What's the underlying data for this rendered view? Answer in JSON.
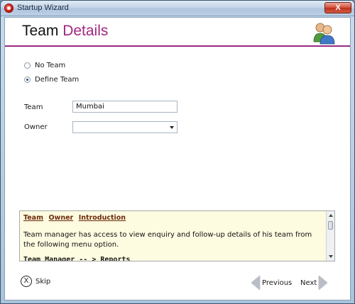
{
  "window": {
    "title": "Startup Wizard",
    "close_label": "X"
  },
  "header": {
    "title_part1": "Team",
    "title_part2": "Details",
    "accent_color": "#a12880",
    "icon": "users-icon"
  },
  "team_mode": {
    "options": [
      {
        "label": "No Team",
        "checked": false
      },
      {
        "label": "Define Team",
        "checked": true
      }
    ]
  },
  "form": {
    "team_label": "Team",
    "team_value": "Mumbai",
    "owner_label": "Owner",
    "owner_value": ""
  },
  "info": {
    "links": [
      "Team",
      "Owner",
      "Introduction"
    ],
    "body": "Team manager has access to view enquiry and follow-up details of his team from the following menu option.",
    "bold_line": "Team Manager -- > Reports"
  },
  "footer": {
    "skip_icon": "X",
    "skip_label": "Skip",
    "previous_label": "Previous",
    "next_label": "Next"
  }
}
